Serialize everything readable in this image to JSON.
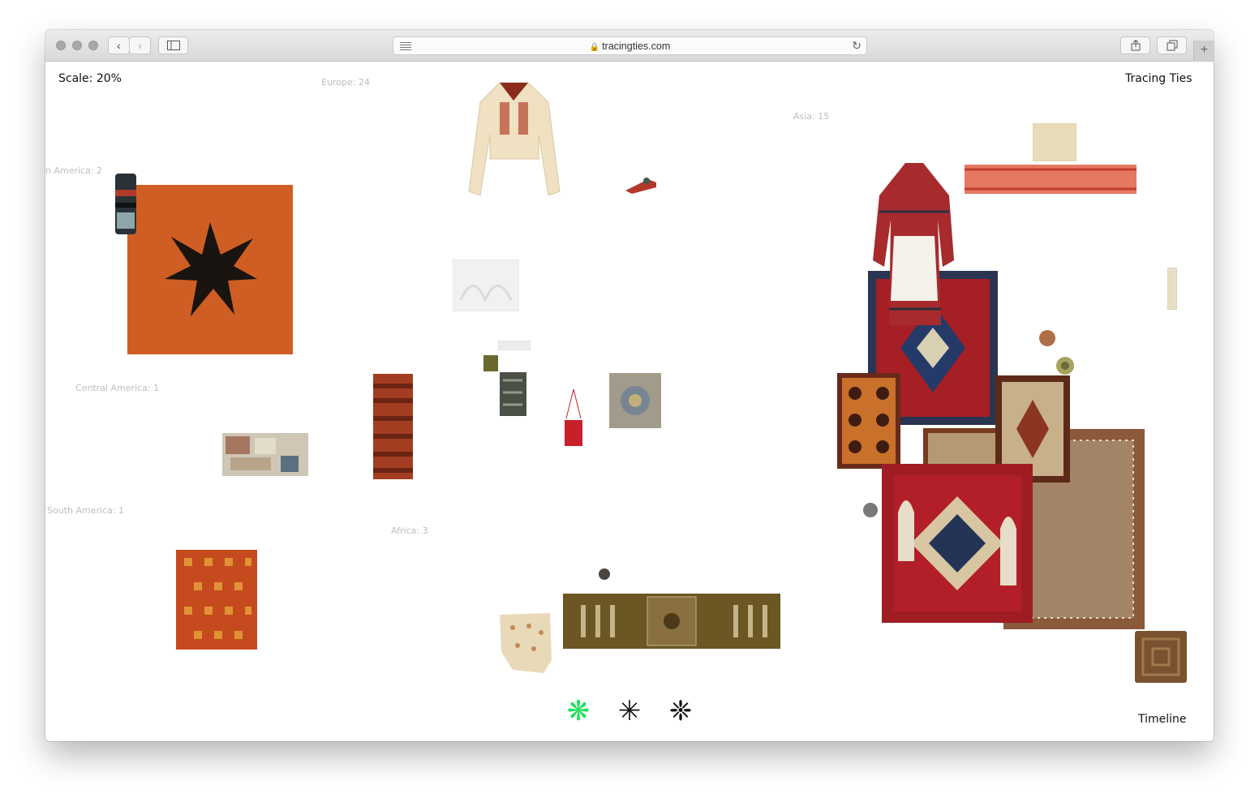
{
  "browser": {
    "url": "tracingties.com"
  },
  "header": {
    "scale_label": "Scale: 20%",
    "site_title": "Tracing Ties"
  },
  "footer": {
    "timeline_label": "Timeline"
  },
  "regions": {
    "north_america": "n America: 2",
    "europe": "Europe: 24",
    "asia": "Asia: 15",
    "central_america": "Central America: 1",
    "south_america": "South America: 1",
    "africa": "Africa: 3"
  },
  "filters": [
    {
      "name": "flower-filter",
      "glyph": "❋",
      "color": "#1ee05c"
    },
    {
      "name": "star-filter",
      "glyph": "✳",
      "color": "#111111"
    },
    {
      "name": "pattern-filter",
      "glyph": "❈",
      "color": "#111111"
    }
  ],
  "colors": {
    "accent_active": "#1ee05c",
    "orange_quilt": "#d4642a",
    "rug_red": "#9e1c22"
  }
}
